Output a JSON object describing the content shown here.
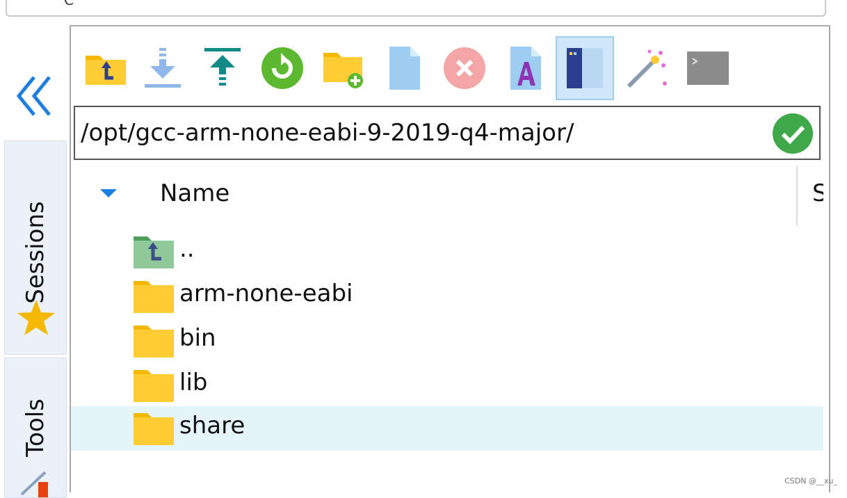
{
  "top_field": {
    "glyph": "C"
  },
  "left_rail": {
    "collapse_icon": "double-chevron-left-icon",
    "tabs": [
      {
        "label": "Sessions",
        "icon": "star-icon",
        "color": "#f5b800"
      },
      {
        "label": "Tools",
        "icon": "tools-icon"
      }
    ]
  },
  "toolbar": {
    "buttons": [
      {
        "name": "parent-directory-button",
        "icon": "folder-up-icon"
      },
      {
        "name": "download-button",
        "icon": "download-icon"
      },
      {
        "name": "upload-button",
        "icon": "upload-icon"
      },
      {
        "name": "refresh-button",
        "icon": "refresh-icon"
      },
      {
        "name": "new-folder-button",
        "icon": "new-folder-icon"
      },
      {
        "name": "new-file-button",
        "icon": "new-file-icon"
      },
      {
        "name": "delete-button",
        "icon": "delete-icon"
      },
      {
        "name": "rename-button",
        "icon": "rename-icon"
      },
      {
        "name": "toggle-panel-button",
        "icon": "panel-icon",
        "active": true
      },
      {
        "name": "magic-wand-button",
        "icon": "magic-wand-icon"
      },
      {
        "name": "terminal-button",
        "icon": "terminal-icon"
      }
    ]
  },
  "path_bar": {
    "value": "/opt/gcc-arm-none-eabi-9-2019-q4-major/",
    "confirm_icon": "checkmark-icon"
  },
  "file_list": {
    "columns": [
      "Name",
      "S"
    ],
    "sort_icon": "sort-down-icon",
    "rows": [
      {
        "name": "..",
        "type": "parent"
      },
      {
        "name": "arm-none-eabi",
        "type": "folder"
      },
      {
        "name": "bin",
        "type": "folder"
      },
      {
        "name": "lib",
        "type": "folder"
      },
      {
        "name": "share",
        "type": "folder",
        "selected": true
      }
    ]
  },
  "watermark": "CSDN @__xu_"
}
